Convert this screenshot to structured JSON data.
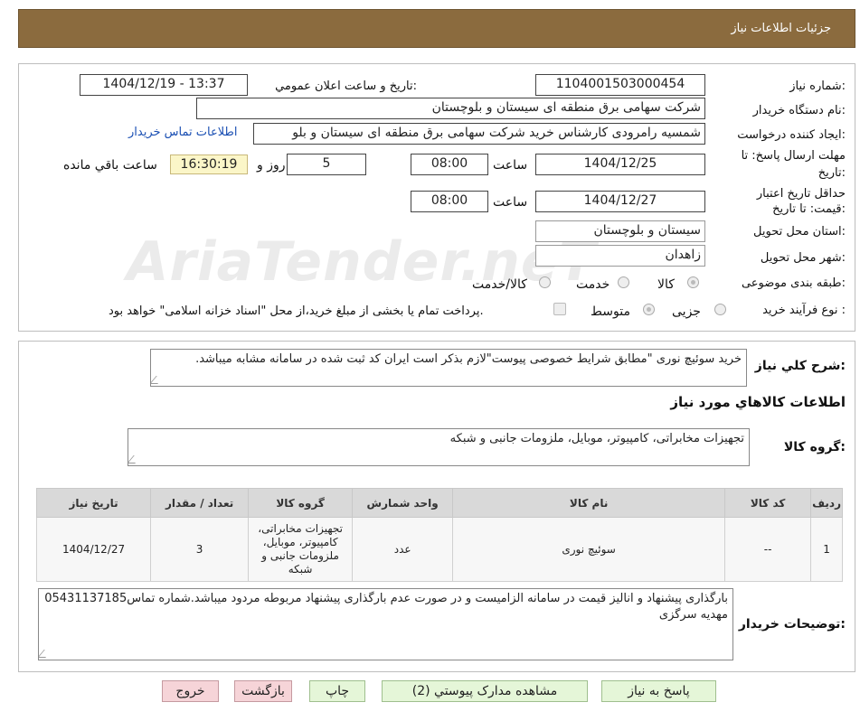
{
  "header": {
    "title": "جزئیات اطلاعات نیاز"
  },
  "watermark": {
    "text": "AriaTender.neT"
  },
  "form": {
    "need_number_label": "شماره نیاز:",
    "need_number": "1104001503000454",
    "announce_label": "تاریخ و ساعت اعلان عمومي:",
    "announce_value": "1404/12/19 - 13:37",
    "buyer_org_label": "نام دستگاه خریدار:",
    "buyer_org": "شرکت سهامی برق منطقه ای سیستان و بلوچستان",
    "creator_label": "ایجاد کننده درخواست:",
    "creator": "شمسیه رامرودی کارشناس خرید شرکت سهامی برق منطقه ای سیستان و بلو",
    "contact_link": "اطلاعات تماس خریدار",
    "reply_deadline_label_1": "مهلت ارسال پاسخ: تا",
    "reply_deadline_label_2": "تاریخ:",
    "reply_date": "1404/12/25",
    "time_label": "ساعت",
    "reply_time": "08:00",
    "days_value": "5",
    "days_label": "روز و",
    "remaining_time": "16:30:19",
    "remaining_label": "ساعت باقي مانده",
    "validity_label_1": "حداقل تاریخ اعتبار",
    "validity_label_2": "قیمت: تا تاریخ:",
    "validity_date": "1404/12/27",
    "validity_time_label": "ساعت",
    "validity_time": "08:00",
    "province_label": "استان محل تحویل:",
    "province": "سیستان و بلوچستان",
    "city_label": "شهر محل تحویل:",
    "city": "زاهدان",
    "category_label": "طبقه بندی موضوعی:",
    "category_options": [
      "کالا",
      "خدمت",
      "کالا/خدمت"
    ],
    "category_selected": "کالا",
    "process_label": "نوع فرآیند خرید :",
    "process_options": [
      "جزیی",
      "متوسط"
    ],
    "payment_note": "پرداخت تمام یا بخشی از مبلغ خرید،از محل \"اسناد خزانه اسلامی\" خواهد بود."
  },
  "details": {
    "summary_label": "شرح کلي نیاز:",
    "summary": "خرید سوئیچ نوری \"مطابق شرایط خصوصی پیوست\"لازم بذکر است ایران کد ثبت شده در سامانه مشابه میباشد.",
    "items_title": "اطلاعات کالاهاي مورد نیاز",
    "group_label": "گروه کالا:",
    "group_value": "تجهیزات مخابراتی، کامپیوتر، موبایل، ملزومات جانبی و شبکه",
    "table": {
      "headers": [
        "ردیف",
        "کد کالا",
        "نام کالا",
        "واحد شمارش",
        "گروه کالا",
        "تعداد / مقدار",
        "تاریخ نیاز"
      ],
      "rows": [
        [
          "1",
          "--",
          "سوئیچ نوری",
          "عدد",
          "تجهیزات مخابراتی، کامپیوتر، موبایل، ملزومات جانبی و شبکه",
          "3",
          "1404/12/27"
        ]
      ]
    },
    "buyer_notes_label": "توضیحات خریدار:",
    "buyer_notes": "بارگذاری پیشنهاد و انالیز قیمت در سامانه الزامیست و در صورت عدم بارگذاری پیشنهاد مربوطه مردود میباشد.شماره تماس05431137185 مهدیه سرگزی"
  },
  "buttons": {
    "reply": "پاسخ به نیاز",
    "attachments": "مشاهده مدارک پیوستي (2)",
    "print": "چاپ",
    "back": "بازگشت",
    "exit": "خروج"
  }
}
